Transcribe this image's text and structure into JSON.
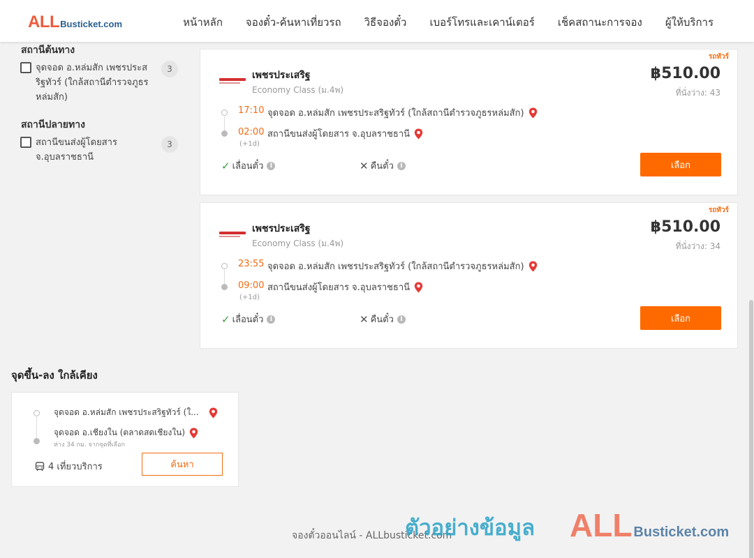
{
  "header": {
    "logo_all": "ALL",
    "logo_rest": "Busticket.com",
    "nav": [
      "หน้าหลัก",
      "จองตั๋ว-ค้นหาเที่ยวรถ",
      "วิธีจองตั๋ว",
      "เบอร์โทรและเคาน์เตอร์",
      "เช็คสถานะการจอง",
      "ผู้ให้บริการ"
    ]
  },
  "filters": {
    "origin_title": "สถานีต้นทาง",
    "origin_items": [
      {
        "label": "จุดจอด อ.หล่มสัก เพชรประสริฐทัวร์ (ใกล้สถานีตำรวจภูธรหล่มสัก)",
        "count": "3"
      }
    ],
    "destination_title": "สถานีปลายทาง",
    "destination_items": [
      {
        "label": "สถานีขนส่งผู้โดยสาร จ.อุบลราชธานี",
        "count": "3"
      }
    ]
  },
  "trips": [
    {
      "tag": "รถทัวร์",
      "operator": "เพชรประเสริฐ",
      "class": "Economy Class (ม.4พ)",
      "price": "฿510.00",
      "seats": "ที่นั่งว่าง: 43",
      "depart_time": "17:10",
      "depart_stop": "จุดจอด อ.หล่มสัก เพชรประสริฐทัวร์ (ใกล้สถานีตำรวจภูธรหล่มสัก)",
      "arrive_time": "02:00",
      "arrive_stop": "สถานีขนส่งผู้โดยสาร จ.อุบลราชธานี",
      "day_offset": "(+1d)",
      "reschedule": "เลื่อนตั๋ว",
      "refund": "คืนตั๋ว",
      "select": "เลือก"
    },
    {
      "tag": "รถทัวร์",
      "operator": "เพชรประเสริฐ",
      "class": "Economy Class (ม.4พ)",
      "price": "฿510.00",
      "seats": "ที่นั่งว่าง: 34",
      "depart_time": "23:55",
      "depart_stop": "จุดจอด อ.หล่มสัก เพชรประสริฐทัวร์ (ใกล้สถานีตำรวจภูธรหล่มสัก)",
      "arrive_time": "09:00",
      "arrive_stop": "สถานีขนส่งผู้โดยสาร จ.อุบลราชธานี",
      "day_offset": "(+1d)",
      "reschedule": "เลื่อนตั๋ว",
      "refund": "คืนตั๋ว",
      "select": "เลือก"
    }
  ],
  "nearby": {
    "title": "จุดขึ้น-ลง ใกล้เคียง",
    "from": "จุดจอด อ.หล่มสัก เพชรประสริฐทัวร์ (ใ...",
    "to": "จุดจอด อ.เชียงใน (ตลาดสดเชียงใน)",
    "distance": "ห่าง 34 กม. จากจุดที่เลือก",
    "trips": "4 เที่ยวบริการ",
    "search": "ค้นหา"
  },
  "footer": "จองตั๋วออนไลน์ - ALLbusticket.com",
  "watermark": {
    "text": "ตัวอย่างข้อมูล",
    "logo_all": "ALL",
    "logo_rest": "Busticket.com"
  },
  "colors": {
    "accent": "#ff6a00",
    "brand_red": "#ee5a3c",
    "brand_blue": "#2a5f8f",
    "check_green": "#3a9c3a"
  }
}
